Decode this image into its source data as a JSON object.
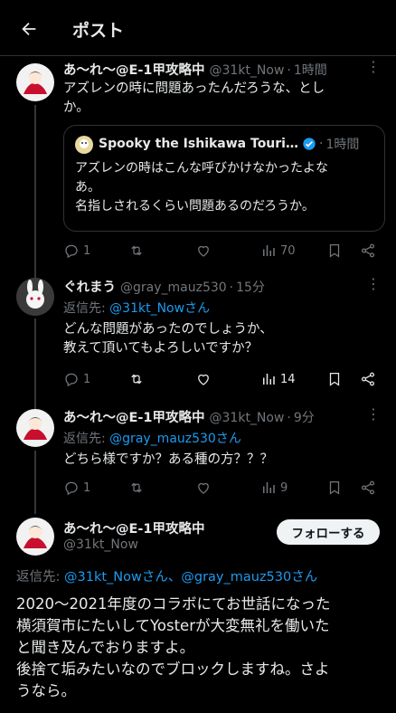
{
  "header": {
    "title": "ポスト"
  },
  "tweets": [
    {
      "name": "あ〜れ〜@E-1甲攻略中",
      "handle": "@31kt_Now",
      "time": "1時間",
      "text": "アズレンの時に問題あったんだろうな、とし\nか。",
      "quote": {
        "name": "Spooky the Ishikawa Touri…",
        "time": "1時間",
        "text": "アズレンの時はこんな呼びかけなかったよな\nあ。\n名指しされるくらい問題あるのだろうか。"
      },
      "replies": "1",
      "views": "70"
    },
    {
      "name": "ぐれまう",
      "handle": "@gray_mauz530",
      "time": "15分",
      "reply_prefix": "返信先: ",
      "reply_to": "@31kt_Nowさん",
      "text": "どんな問題があったのでしょうか、\n教えて頂いてもよろしいですか？",
      "replies": "1",
      "views": "14"
    },
    {
      "name": "あ〜れ〜@E-1甲攻略中",
      "handle": "@31kt_Now",
      "time": "9分",
      "reply_prefix": "返信先: ",
      "reply_to": "@gray_mauz530さん",
      "text": "どちら様ですか？ある種の方？？？",
      "replies": "1",
      "views": "9"
    }
  ],
  "main": {
    "name": "あ〜れ〜@E-1甲攻略中",
    "handle": "@31kt_Now",
    "follow_label": "フォローする",
    "reply_prefix": "返信先: ",
    "reply_to": "@31kt_Nowさん、@gray_mauz530さん",
    "text": "2020〜2021年度のコラボにてお世話になった\n横須賀市にたいしてYosterが大変無礼を働いた\nと聞き及んでおりますよ。\n後捨て垢みたいなのでブロックしますね。さよ\nうなら。"
  },
  "icons": [
    "back-arrow-icon",
    "verified-badge-icon",
    "reply-icon",
    "retweet-icon",
    "like-icon",
    "views-icon",
    "bookmark-icon",
    "share-icon",
    "more-icon"
  ],
  "colors": {
    "background": "#000000",
    "text": "#e7e9ea",
    "muted": "#71767b",
    "link": "#1d9bf0",
    "divider": "#2f3336",
    "follow_bg": "#eff3f4"
  }
}
